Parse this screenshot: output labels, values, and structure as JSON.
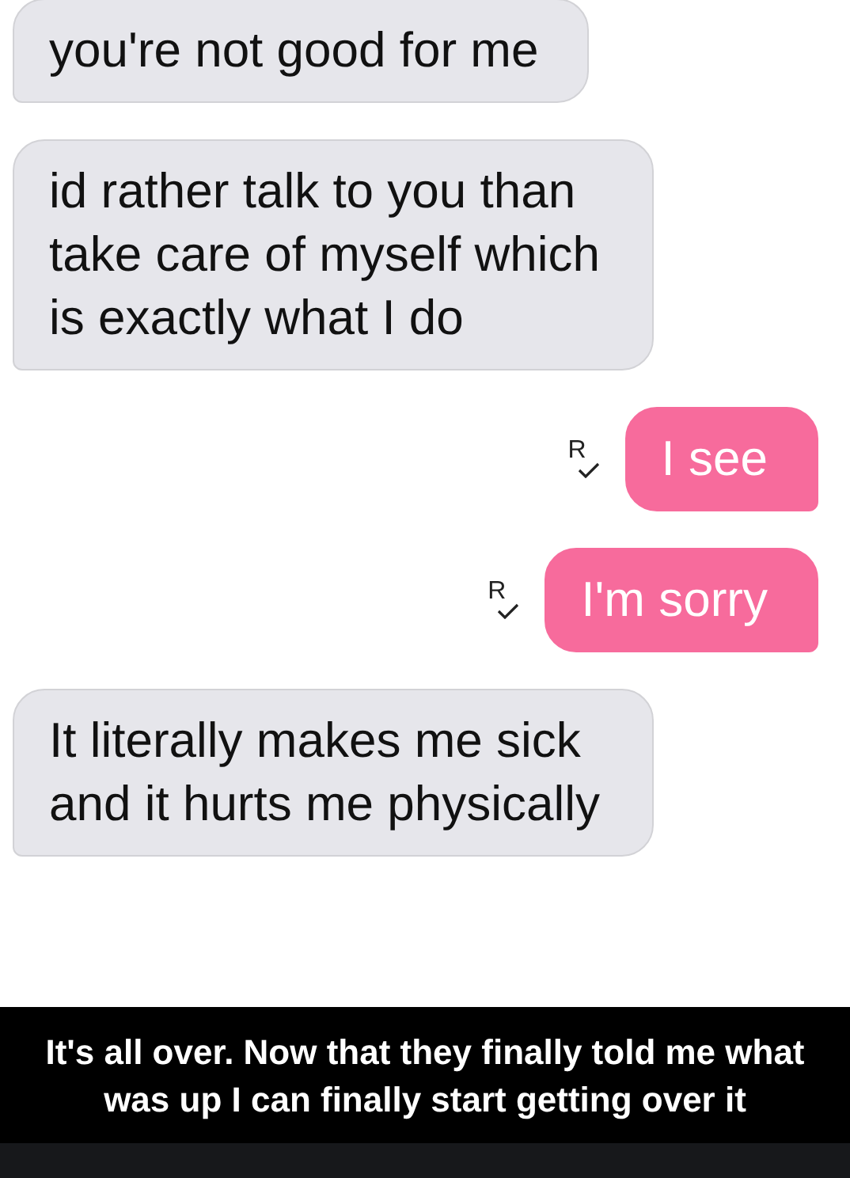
{
  "messages": [
    {
      "outgoing": false,
      "text": "you're not good for me"
    },
    {
      "outgoing": false,
      "text": "id rather talk to you than take care of myself which is exactly what I do"
    },
    {
      "outgoing": true,
      "text": "I see",
      "read_mark": "R"
    },
    {
      "outgoing": true,
      "text": "I'm sorry",
      "read_mark": "R"
    },
    {
      "outgoing": false,
      "text": "It literally makes me sick and it hurts me physically"
    }
  ],
  "caption": "It's all over. Now that they finally told me what was up I can finally start getting over it"
}
